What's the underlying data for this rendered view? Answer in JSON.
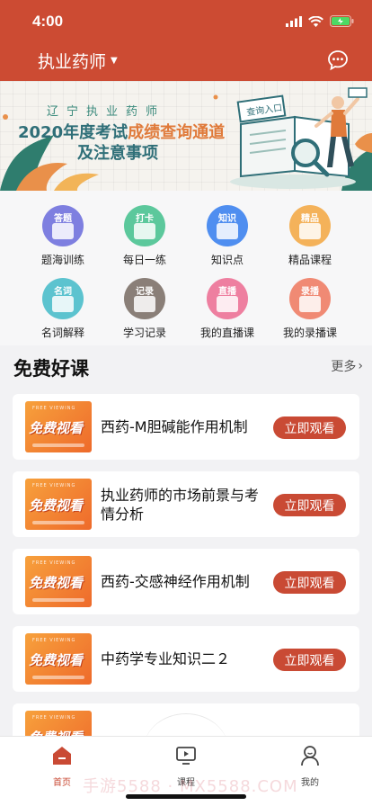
{
  "status_bar": {
    "time": "4:00"
  },
  "header": {
    "title": "执业药师"
  },
  "banner": {
    "line1": "辽宁执业药师",
    "line2_prefix": "2020年度考试",
    "line2_highlight": "成绩查询通道",
    "line3": "及注意事项",
    "sign_text": "查询入口"
  },
  "grid": {
    "items": [
      {
        "label": "题海训练",
        "badge": "答题",
        "color": "#7e7fe0"
      },
      {
        "label": "每日一练",
        "badge": "打卡",
        "color": "#5cc89c"
      },
      {
        "label": "知识点",
        "badge": "知识",
        "color": "#4f8ef0"
      },
      {
        "label": "精品课程",
        "badge": "精品",
        "color": "#f4b25a"
      },
      {
        "label": "名词解释",
        "badge": "名词",
        "color": "#5cc3cf"
      },
      {
        "label": "学习记录",
        "badge": "记录",
        "color": "#8a7f78"
      },
      {
        "label": "我的直播课",
        "badge": "直播",
        "color": "#ee7fa0"
      },
      {
        "label": "我的录播课",
        "badge": "录播",
        "color": "#f08a74"
      }
    ]
  },
  "section": {
    "title": "免费好课",
    "more": "更多"
  },
  "courses": [
    {
      "title": "西药-M胆碱能作用机制",
      "button": "立即观看",
      "thumb_text": "免费视看"
    },
    {
      "title": "执业药师的市场前景与考情分析",
      "button": "立即观看",
      "thumb_text": "免费视看"
    },
    {
      "title": "西药-交感神经作用机制",
      "button": "立即观看",
      "thumb_text": "免费视看"
    },
    {
      "title": "中药学专业知识二２",
      "button": "立即观看",
      "thumb_text": "免费视看"
    },
    {
      "title": "",
      "button": "",
      "thumb_text": "免费视看"
    }
  ],
  "tabbar": {
    "tabs": [
      {
        "label": "首页"
      },
      {
        "label": "课程"
      },
      {
        "label": "我的"
      }
    ]
  },
  "watermark": "手游5588 · MX5588.COM",
  "colors": {
    "brand": "#cc4b33",
    "button": "#c94a34"
  }
}
